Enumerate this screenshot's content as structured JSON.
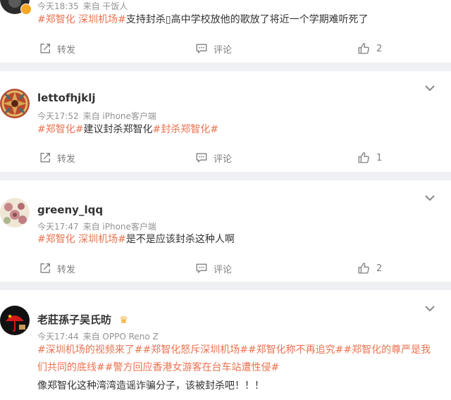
{
  "comments": [
    {
      "meta_time": "今天18:35",
      "meta_source": "来自 干饭人",
      "text": [
        {
          "t": "#郑智化 深圳机场#",
          "tag": true
        },
        {
          "t": "支持封杀▯高中学校放他的歌放了将近一个学期难听死了",
          "tag": false
        }
      ],
      "repost_label": "转发",
      "comment_label": "评论",
      "like_count": "2"
    },
    {
      "username": "lettofhjklj",
      "meta_time": "今天17:52",
      "meta_source": "来自 iPhone客户端",
      "text": [
        {
          "t": "#郑智化#",
          "tag": true
        },
        {
          "t": "建议封杀郑智化",
          "tag": false
        },
        {
          "t": "#封杀郑智化#",
          "tag": true
        }
      ],
      "repost_label": "转发",
      "comment_label": "评论",
      "like_count": "1"
    },
    {
      "username": "greeny_lqq",
      "meta_time": "今天17:47",
      "meta_source": "来自 iPhone客户端",
      "text": [
        {
          "t": "#郑智化 深圳机场#",
          "tag": true
        },
        {
          "t": "是不是应该封杀这种人啊",
          "tag": false
        }
      ],
      "repost_label": "转发",
      "comment_label": "评论",
      "like_count": "2"
    },
    {
      "username": "老莊孫子吴氏昉",
      "meta_time": "今天17:44",
      "meta_source": "来自 OPPO Reno Z",
      "text": [
        {
          "t": "#深圳机场的视频来了##郑智化怒斥深圳机场##郑智化称不再追究##郑智化的尊严是我们共同的底线##警方回应香港女游客在台车站遭性侵#",
          "tag": true
        }
      ],
      "text2": "像郑智化这种湾湾造谣诈骗分子，该被封杀吧！！！"
    }
  ],
  "icons": {
    "repost": "repost-icon",
    "comment": "comment-icon",
    "like": "thumbs-up-icon",
    "more": "chevron-down-icon",
    "vip": "vip-crown-icon"
  },
  "colors": {
    "tag": "#eb7350",
    "meta": "#939393",
    "background": "#eef0f3"
  }
}
